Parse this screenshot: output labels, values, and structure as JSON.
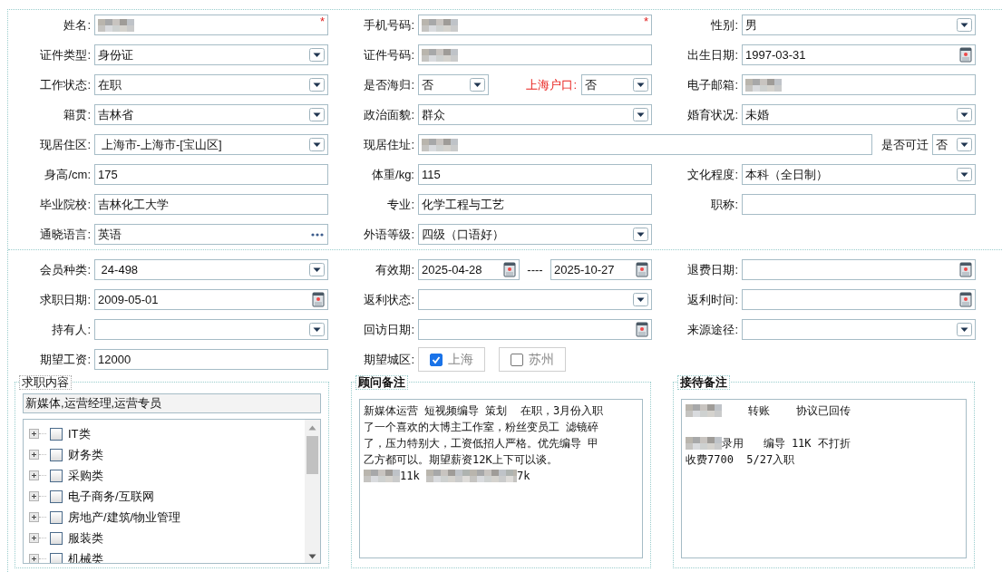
{
  "sections": [
    {
      "rows": [
        [
          {
            "label": "姓名:",
            "control": {
              "kind": "text",
              "masked": true,
              "required_mark": "*"
            }
          },
          {
            "label": "手机号码:",
            "control": {
              "kind": "text",
              "masked": true,
              "required_mark": "*"
            }
          },
          {
            "label": "性别:",
            "control": {
              "kind": "select",
              "value": "男"
            }
          }
        ],
        [
          {
            "label": "证件类型:",
            "control": {
              "kind": "select",
              "value": "身份证"
            }
          },
          {
            "label": "证件号码:",
            "control": {
              "kind": "text",
              "masked": true
            }
          },
          {
            "label": "出生日期:",
            "control": {
              "kind": "date",
              "value": "1997-03-31"
            }
          }
        ],
        [
          {
            "label": "工作状态:",
            "control": {
              "kind": "select",
              "value": "在职"
            }
          },
          {
            "label": "是否海归:",
            "control": {
              "kind": "select",
              "value": "否"
            },
            "suffix": {
              "kind": "field",
              "label": "上海户口:",
              "highlight": true,
              "control": {
                "kind": "select",
                "value": "否"
              }
            }
          },
          {
            "label": "电子邮箱:",
            "control": {
              "kind": "text",
              "masked": true
            }
          }
        ],
        [
          {
            "label": "籍贯:",
            "control": {
              "kind": "select",
              "value": "吉林省"
            }
          },
          {
            "label": "政治面貌:",
            "control": {
              "kind": "select",
              "value": "群众"
            }
          },
          {
            "label": "婚育状况:",
            "control": {
              "kind": "select",
              "value": "未婚"
            }
          }
        ],
        [
          {
            "label": "现居住区:",
            "control": {
              "kind": "select",
              "value": " 上海市-上海市-[宝山区]"
            }
          },
          {
            "label": "现居住址:",
            "wide": true,
            "control": {
              "kind": "text",
              "masked": true
            },
            "suffix": {
              "kind": "field",
              "label": "是否可迁",
              "control": {
                "kind": "select",
                "value": "否"
              }
            }
          }
        ],
        [
          {
            "label": "身高/cm:",
            "control": {
              "kind": "text",
              "value": "175"
            }
          },
          {
            "label": "体重/kg:",
            "control": {
              "kind": "text",
              "value": "115"
            }
          },
          {
            "label": "文化程度:",
            "control": {
              "kind": "select",
              "value": "本科（全日制）"
            }
          }
        ],
        [
          {
            "label": "毕业院校:",
            "control": {
              "kind": "text",
              "value": "吉林化工大学"
            }
          },
          {
            "label": "专业:",
            "control": {
              "kind": "text",
              "value": "化学工程与工艺"
            }
          },
          {
            "label": "职称:",
            "control": {
              "kind": "text"
            }
          }
        ],
        [
          {
            "label": "通晓语言:",
            "control": {
              "kind": "lookup",
              "value": "英语"
            }
          },
          {
            "label": "外语等级:",
            "control": {
              "kind": "select",
              "value": "四级（口语好）"
            }
          }
        ]
      ]
    },
    {
      "rows": [
        [
          {
            "label": "会员种类:",
            "control": {
              "kind": "select",
              "value": " 24-498"
            }
          },
          {
            "label": "有效期:",
            "control": {
              "kind": "date",
              "value": "2025-04-28"
            },
            "suffix": {
              "kind": "range",
              "separator": "----",
              "control": {
                "kind": "date",
                "value": "2025-10-27"
              }
            }
          },
          {
            "label": "退费日期:",
            "control": {
              "kind": "date"
            }
          }
        ],
        [
          {
            "label": "求职日期:",
            "control": {
              "kind": "date",
              "value": "2009-05-01"
            }
          },
          {
            "label": "返利状态:",
            "control": {
              "kind": "select"
            }
          },
          {
            "label": "返利时间:",
            "control": {
              "kind": "date"
            }
          }
        ],
        [
          {
            "label": "持有人:",
            "control": {
              "kind": "select"
            }
          },
          {
            "label": "回访日期:",
            "control": {
              "kind": "date"
            }
          },
          {
            "label": "来源途径:",
            "control": {
              "kind": "select"
            }
          }
        ],
        [
          {
            "label": "期望工资:",
            "control": {
              "kind": "text",
              "value": "12000"
            }
          },
          {
            "label": "期望城区:",
            "control": {
              "kind": "checks",
              "options": [
                {
                  "label": "上海",
                  "checked": true
                },
                {
                  "label": "苏州",
                  "checked": false
                }
              ]
            }
          }
        ]
      ]
    }
  ],
  "panels": [
    {
      "kind": "tree",
      "title": "求职内容",
      "summary": "新媒体,运营经理,运营专员",
      "items": [
        {
          "label": "IT类",
          "checked": false,
          "expanded": false
        },
        {
          "label": "财务类",
          "checked": false,
          "expanded": false
        },
        {
          "label": "采购类",
          "checked": false,
          "expanded": false
        },
        {
          "label": "电子商务/互联网",
          "checked": false,
          "expanded": false
        },
        {
          "label": "房地产/建筑/物业管理",
          "checked": false,
          "expanded": false
        },
        {
          "label": "服装类",
          "checked": false,
          "expanded": false
        },
        {
          "label": "机械类",
          "checked": false,
          "expanded": false
        }
      ]
    },
    {
      "kind": "notes",
      "title": "顾问备注",
      "lines": [
        {
          "segments": [
            {
              "text": "新媒体运营 短视频编导 策划  在职，3月份入职"
            }
          ]
        },
        {
          "segments": [
            {
              "text": "了一个喜欢的大博主工作室，粉丝变员工 滤镜碎"
            }
          ]
        },
        {
          "segments": [
            {
              "text": "了，压力特别大，工资低招人严格。优先编导 甲"
            }
          ]
        },
        {
          "segments": [
            {
              "text": "乙方都可以。期望薪资12K上下可以谈。"
            }
          ]
        },
        {
          "segments": [
            {
              "masked": true
            },
            {
              "text": "11k "
            },
            {
              "masked": true,
              "long": true
            },
            {
              "text": "7k"
            }
          ]
        }
      ]
    },
    {
      "kind": "notes",
      "title": "接待备注",
      "lines": [
        {
          "segments": [
            {
              "masked": true
            },
            {
              "text": "    转账    协议已回传"
            }
          ]
        },
        {
          "space_before": true,
          "segments": [
            {
              "masked": true
            },
            {
              "text": "录用   编导 11K 不打折"
            }
          ]
        },
        {
          "segments": [
            {
              "text": "收费7700  5/27入职"
            }
          ]
        }
      ]
    }
  ]
}
